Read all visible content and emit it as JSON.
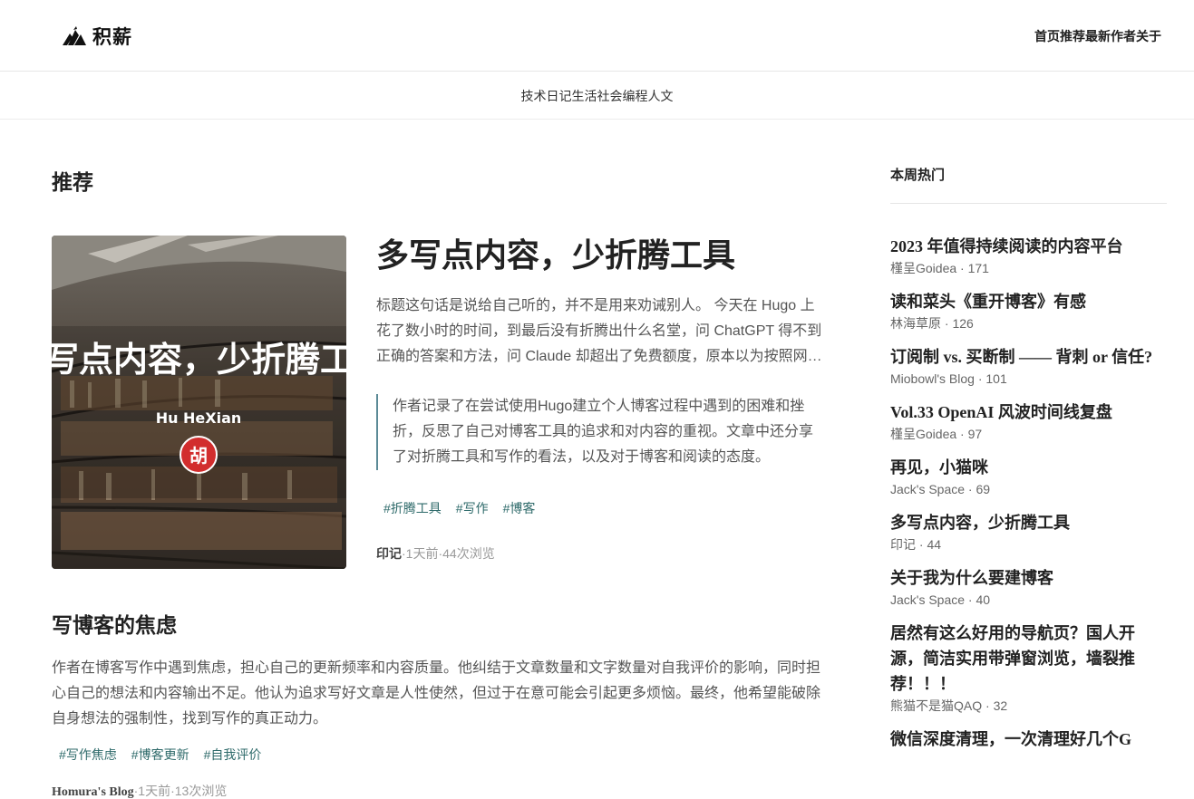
{
  "header": {
    "logo_text": "积薪",
    "nav": [
      "首页",
      "推荐",
      "最新",
      "作者",
      "关于"
    ]
  },
  "categories": [
    "技术",
    "日记",
    "生活",
    "社会",
    "编程",
    "人文"
  ],
  "main": {
    "section_title": "推荐",
    "featured": {
      "image": {
        "overlay_title": "写点内容，少折腾工",
        "overlay_author": "Hu HeXian",
        "seal_char": "胡"
      },
      "title": "多写点内容，少折腾工具",
      "excerpt": "标题这句话是说给自己听的，并不是用来劝诫别人。 今天在 Hugo 上花了数小时的时间，到最后没有折腾出什么名堂，问 ChatGPT 得不到正确的答案和方法，问 Claude 却超出了免费额度，原本以为按照网…",
      "summary": "作者记录了在尝试使用Hugo建立个人博客过程中遇到的困难和挫折，反思了自己对博客工具的追求和对内容的重视。文章中还分享了对折腾工具和写作的看法，以及对于博客和阅读的态度。",
      "tags": [
        "#折腾工具",
        "#写作",
        "#博客"
      ],
      "meta": {
        "author": "印记",
        "sep": "·",
        "time": "1天前",
        "views": "44次浏览"
      }
    },
    "second": {
      "title": "写博客的焦虑",
      "excerpt": "作者在博客写作中遇到焦虑，担心自己的更新频率和内容质量。他纠结于文章数量和文字数量对自我评价的影响，同时担心自己的想法和内容输出不足。他认为追求写好文章是人性使然，但过于在意可能会引起更多烦恼。最终，他希望能破除自身想法的强制性，找到写作的真正动力。",
      "tags": [
        "#写作焦虑",
        "#博客更新",
        "#自我评价"
      ],
      "meta": {
        "author": "Homura's Blog",
        "sep": "·",
        "time": "1天前",
        "views": "13次浏览"
      }
    }
  },
  "sidebar": {
    "title": "本周热门",
    "items": [
      {
        "title": "2023 年值得持续阅读的内容平台",
        "author": "槿呈Goidea",
        "count": "171"
      },
      {
        "title": "读和菜头《重开博客》有感",
        "author": "林海草原",
        "count": "126"
      },
      {
        "title": "订阅制 vs. 买断制 —— 背刺 or 信任?",
        "author": "Miobowl's Blog",
        "count": "101"
      },
      {
        "title": "Vol.33 OpenAI 风波时间线复盘",
        "author": "槿呈Goidea",
        "count": "97"
      },
      {
        "title": "再见，小猫咪",
        "author": "Jack's Space",
        "count": "69"
      },
      {
        "title": "多写点内容，少折腾工具",
        "author": "印记",
        "count": "44"
      },
      {
        "title": "关于我为什么要建博客",
        "author": "Jack's Space",
        "count": "40"
      },
      {
        "title": "居然有这么好用的导航页？国人开源，简洁实用带弹窗浏览，墙裂推荐！！！",
        "author": "熊猫不是猫QAQ",
        "count": "32"
      },
      {
        "title": "微信深度清理，一次清理好几个G",
        "author": "",
        "count": ""
      }
    ]
  }
}
